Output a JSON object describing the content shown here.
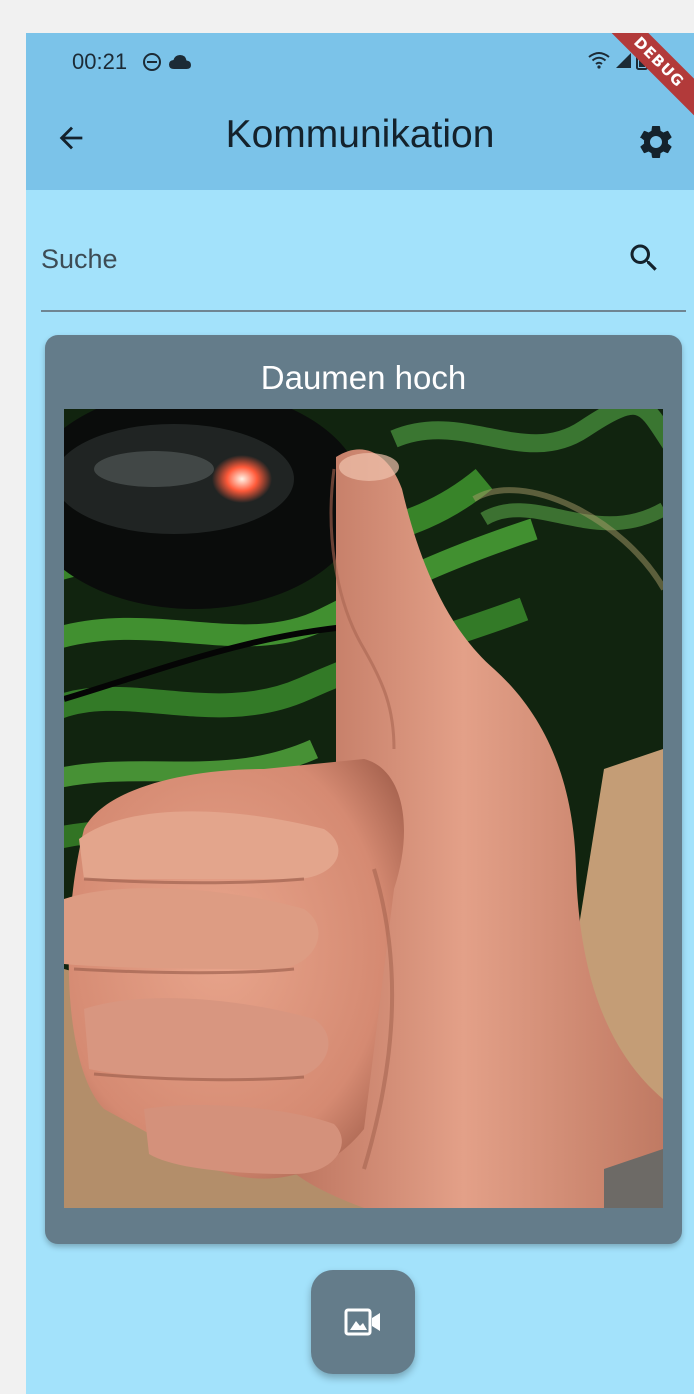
{
  "status_bar": {
    "time": "00:21",
    "left_icons": [
      "do-not-disturb-icon",
      "cloud-icon"
    ],
    "right_icons": [
      "wifi-icon",
      "signal-icon",
      "battery-icon"
    ],
    "debug_label": "DEBUG"
  },
  "app_bar": {
    "title": "Kommunikation",
    "back_icon": "arrow-back-icon",
    "settings_icon": "gear-icon",
    "background": "#7bc3e9"
  },
  "search": {
    "placeholder": "Suche",
    "value": "",
    "icon": "search-icon"
  },
  "card": {
    "title": "Daumen hoch",
    "image_subject": "thumbs-up hand photo",
    "background": "#647c8a"
  },
  "media_button": {
    "icon": "photo-video-icon"
  },
  "colors": {
    "page_background": "#a3e2fb",
    "accent": "#647c8a"
  }
}
